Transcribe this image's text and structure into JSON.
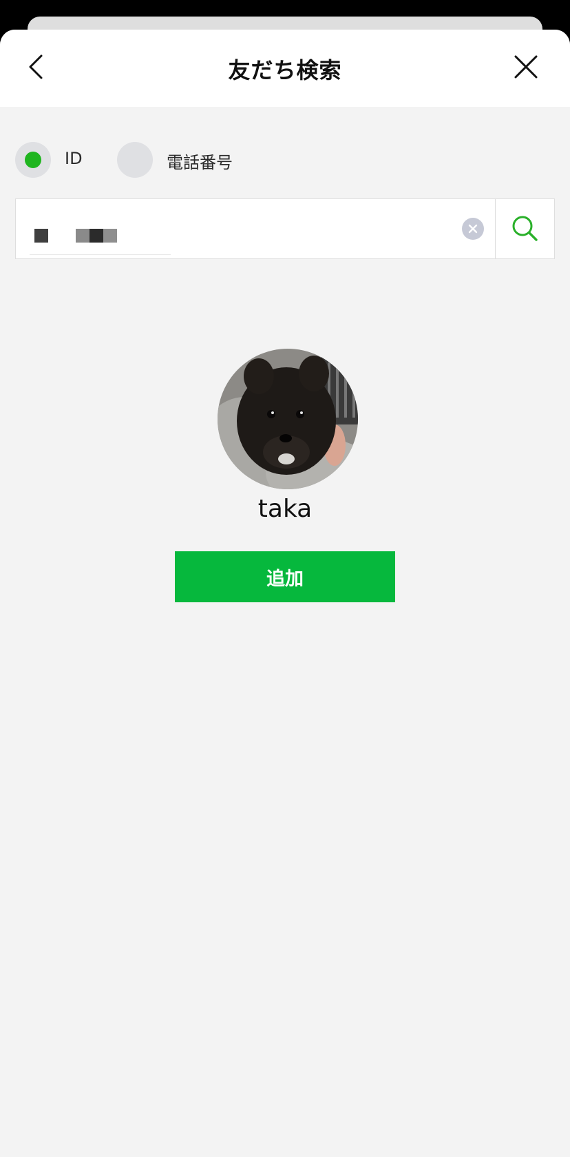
{
  "header": {
    "title": "友だち検索",
    "back_icon": "chevron-left-icon",
    "close_icon": "close-icon"
  },
  "search_type": {
    "options": [
      {
        "label": "ID",
        "selected": true
      },
      {
        "label": "電話番号",
        "selected": false
      }
    ]
  },
  "search": {
    "value": "",
    "value_redacted": true,
    "clear_icon": "clear-icon",
    "search_icon": "search-icon"
  },
  "result": {
    "avatar_icon": "avatar-photo",
    "name": "taka",
    "add_label": "追加"
  },
  "colors": {
    "accent_green": "#06b83d",
    "radio_green": "#1fb51f",
    "background": "#f3f3f3"
  }
}
